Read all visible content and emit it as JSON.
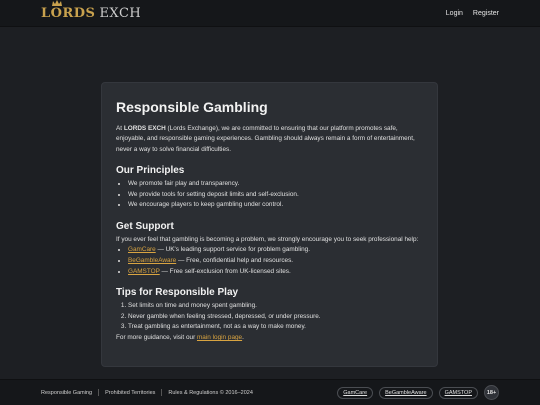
{
  "header": {
    "logo_main": "LORDS",
    "logo_sub": "EXCH",
    "login": "Login",
    "register": "Register"
  },
  "card": {
    "title": "Responsible Gambling",
    "intro_prefix": "At ",
    "intro_brand": "LORDS EXCH",
    "intro_text": " (Lords Exchange), we are committed to ensuring that our platform promotes safe, enjoyable, and responsible gaming experiences. Gambling should always remain a form of entertainment, never a way to solve financial difficulties.",
    "principles": {
      "heading": "Our Principles",
      "items": [
        "We promote fair play and transparency.",
        "We provide tools for setting deposit limits and self-exclusion.",
        "We encourage players to keep gambling under control."
      ]
    },
    "support": {
      "heading": "Get Support",
      "intro": "If you ever feel that gambling is becoming a problem, we strongly encourage you to seek professional help:",
      "items": [
        {
          "link": "GamCare",
          "text": " — UK's leading support service for problem gambling."
        },
        {
          "link": "BeGambleAware",
          "text": " — Free, confidential help and resources."
        },
        {
          "link": "GAMSTOP",
          "text": " — Free self-exclusion from UK-licensed sites."
        }
      ]
    },
    "tips": {
      "heading": "Tips for Responsible Play",
      "items": [
        "Set limits on time and money spent gambling.",
        "Never gamble when feeling stressed, depressed, or under pressure.",
        "Treat gambling as entertainment, not as a way to make money."
      ],
      "more_prefix": "For more guidance, visit our ",
      "more_link": "main login page",
      "more_suffix": "."
    }
  },
  "footer": {
    "links": [
      "Responsible Gaming",
      "Prohibited Territories",
      "Rules & Regulations © 2016–2024"
    ],
    "badges": [
      "GamCare",
      "BeGambleAware",
      "GAMSTOP"
    ],
    "age": "18+"
  },
  "colors": {
    "accent": "#d9a441",
    "background": "#1d1f23",
    "card": "#2b2e33"
  }
}
